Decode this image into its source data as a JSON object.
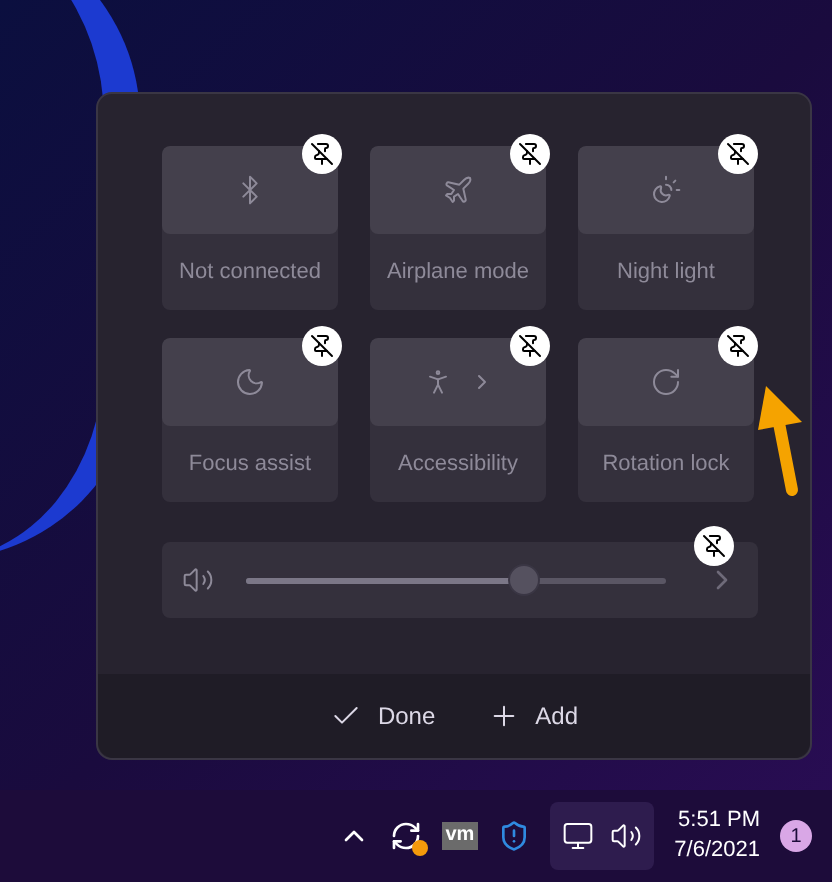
{
  "tiles": [
    {
      "kind": "bluetooth",
      "label": "Not connected"
    },
    {
      "kind": "airplane",
      "label": "Airplane mode"
    },
    {
      "kind": "nightlight",
      "label": "Night light"
    },
    {
      "kind": "focus",
      "label": "Focus assist"
    },
    {
      "kind": "accessibility",
      "label": "Accessibility"
    },
    {
      "kind": "rotation",
      "label": "Rotation lock"
    }
  ],
  "volume": {
    "level": 0.66
  },
  "footer": {
    "done": "Done",
    "add": "Add"
  },
  "taskbar": {
    "vm_label": "vm",
    "time": "5:51 PM",
    "date": "7/6/2021",
    "notification_count": "1"
  }
}
